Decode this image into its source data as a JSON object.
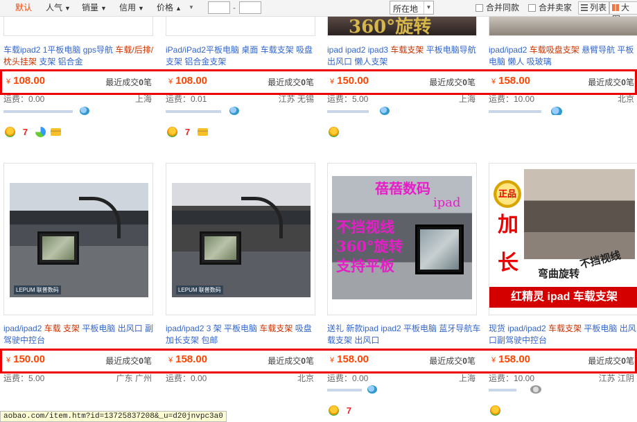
{
  "sortbar": {
    "tabs": [
      {
        "label": "默认",
        "arrow": ""
      },
      {
        "label": "人气",
        "arrow": "▼"
      },
      {
        "label": "销量",
        "arrow": "▼"
      },
      {
        "label": "信用",
        "arrow": "▼"
      },
      {
        "label": "价格",
        "arrow": "▲"
      }
    ],
    "price_dash": "-",
    "location_label": "所在地",
    "merge_same": "合并同款",
    "merge_seller": "合并卖家",
    "view_list": "列表",
    "view_big": "大图"
  },
  "row1": [
    {
      "title_a": "车载ipad2 1平板电脑 gps导航 ",
      "title_kw": "车载/后排/枕头挂架",
      "title_b": " 支架 铝合金",
      "currency": "¥",
      "price": "108.00",
      "sales_prefix": "最近成交",
      "sales_count": "0",
      "sales_suffix": "笔",
      "shipping": "运费：0.00",
      "location": "上海",
      "badges": [
        "flower",
        "seven",
        "refresh",
        "card"
      ]
    },
    {
      "title_a": "iPad/iPad2平板电脑 桌面 车载支架 吸盘支架 铝合金支架",
      "title_kw": "",
      "title_b": "",
      "currency": "¥",
      "price": "108.00",
      "sales_prefix": "最近成交",
      "sales_count": "0",
      "sales_suffix": "笔",
      "shipping": "运费：0.01",
      "location": "江苏 无锡",
      "badges": [
        "flower",
        "seven",
        "card"
      ]
    },
    {
      "title_a": "ipad ipad2 ipad3 ",
      "title_kw": "车载支架",
      "title_b": " 平板电脑导航 出风口 懒人支架",
      "currency": "¥",
      "price": "150.00",
      "sales_prefix": "最近成交",
      "sales_count": "0",
      "sales_suffix": "笔",
      "shipping": "运费：5.00",
      "location": "上海",
      "badges": [
        "flower"
      ]
    },
    {
      "title_a": "ipad/ipad2 ",
      "title_kw": "车载吸盘支架",
      "title_b": " 悬臂导航 平板电脑 懒人 吸玻璃",
      "currency": "¥",
      "price": "158.00",
      "sales_prefix": "最近成交",
      "sales_count": "0",
      "sales_suffix": "笔",
      "shipping": "运费：10.00",
      "location": "北京",
      "badges": []
    }
  ],
  "row2": [
    {
      "title_a": "ipad/ipad2 ",
      "title_kw": "车载 支架",
      "title_b": " 平板电脑 出风口 副驾驶中控台",
      "currency": "¥",
      "price": "150.00",
      "sales_prefix": "最近成交",
      "sales_count": "0",
      "sales_suffix": "笔",
      "shipping": "运费：5.00",
      "location": "广东 广州",
      "photo_tag": "LEPUM 联普数码"
    },
    {
      "title_a": "ipad/ipad2 3 架 平板电脑 ",
      "title_kw": "车载支架",
      "title_b": " 吸盘 加长支架 包邮",
      "currency": "¥",
      "price": "158.00",
      "sales_prefix": "最近成交",
      "sales_count": "0",
      "sales_suffix": "笔",
      "shipping": "运费：0.00",
      "location": "北京",
      "photo_tag": "LEPUM 联普数码"
    },
    {
      "title_a": "送礼 ",
      "title_kw": "",
      "title_b": "新款ipad ipad2 平板电脑 蓝牙导航车载支架 出风口",
      "currency": "¥",
      "price": "158.00",
      "sales_prefix": "最近成交",
      "sales_count": "0",
      "sales_suffix": "笔",
      "shipping": "运费：0.00",
      "location": "上海",
      "promo": {
        "brand": "蓓蓓数码",
        "ipad": "ipad",
        "line1": "不挡视线",
        "line2": "360°旋转",
        "line3": "支持平板"
      }
    },
    {
      "title_a": "现货 ipad/ipad2 ",
      "title_kw": "车载支架",
      "title_b": " 平板电脑 出风口副驾驶中控台",
      "currency": "¥",
      "price": "158.00",
      "sales_prefix": "最近成交",
      "sales_count": "0",
      "sales_suffix": "笔",
      "shipping": "运费：10.00",
      "location": "江苏 江阴",
      "promo": {
        "medal": "正品",
        "jia": "加",
        "chang": "长",
        "s1": "弯曲旋转",
        "s2": "不挡视线",
        "banner": "红精灵 ipad 车载支架"
      }
    }
  ],
  "top_thumb_text": "360°旋转",
  "status_url": "aobao.com/item.htm?id=13725837208&_u=d20jnvpc3a0",
  "colors": {
    "price": "#ff4400",
    "highlight": "#ee0000",
    "link": "#3366cc"
  }
}
